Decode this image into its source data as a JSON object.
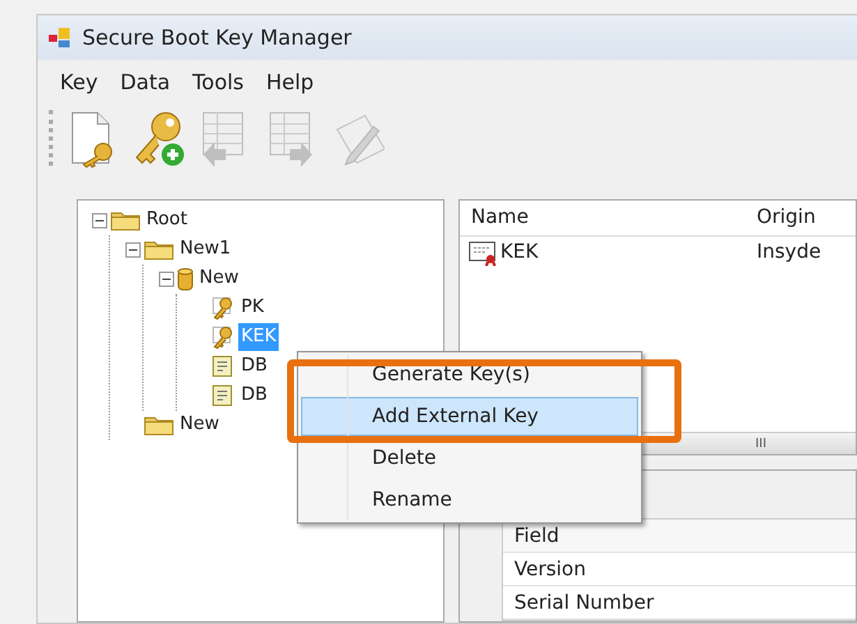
{
  "window": {
    "title": "Secure Boot Key Manager"
  },
  "menu_bar": [
    "Key",
    "Data",
    "Tools",
    "Help"
  ],
  "toolbar": [
    {
      "kind": "new-key",
      "disabled": false
    },
    {
      "kind": "add-key",
      "disabled": false
    },
    {
      "kind": "import",
      "disabled": true
    },
    {
      "kind": "export",
      "disabled": true
    },
    {
      "kind": "sign",
      "disabled": true
    }
  ],
  "tree": [
    {
      "label": "Root",
      "kind": "folder",
      "expanded": true,
      "selected": false,
      "children": [
        {
          "label": "New1",
          "kind": "folder",
          "expanded": true,
          "selected": false,
          "children": [
            {
              "label": "New",
              "kind": "store",
              "expanded": true,
              "selected": false,
              "children": [
                {
                  "label": "PK",
                  "kind": "key",
                  "selected": false
                },
                {
                  "label": "KEK",
                  "kind": "key",
                  "selected": true
                },
                {
                  "label": "DB",
                  "kind": "cert",
                  "selected": false
                },
                {
                  "label": "DB",
                  "kind": "cert",
                  "selected": false
                }
              ]
            }
          ]
        },
        {
          "label": "New",
          "kind": "folder",
          "selected": false
        }
      ]
    }
  ],
  "key_list": {
    "columns": [
      "Name",
      "Origin"
    ],
    "rows": [
      {
        "name": "KEK",
        "origin": "Insyde"
      }
    ],
    "scrollbar_grip": "III"
  },
  "details": {
    "columns": [
      "Field"
    ],
    "rows": [
      "Version",
      "Serial Number"
    ]
  },
  "context_menu": [
    {
      "label": "Generate Key(s)",
      "selected": false
    },
    {
      "label": "Add External Key",
      "selected": true
    },
    {
      "label": "Delete",
      "selected": false
    },
    {
      "label": "Rename",
      "selected": false
    }
  ]
}
